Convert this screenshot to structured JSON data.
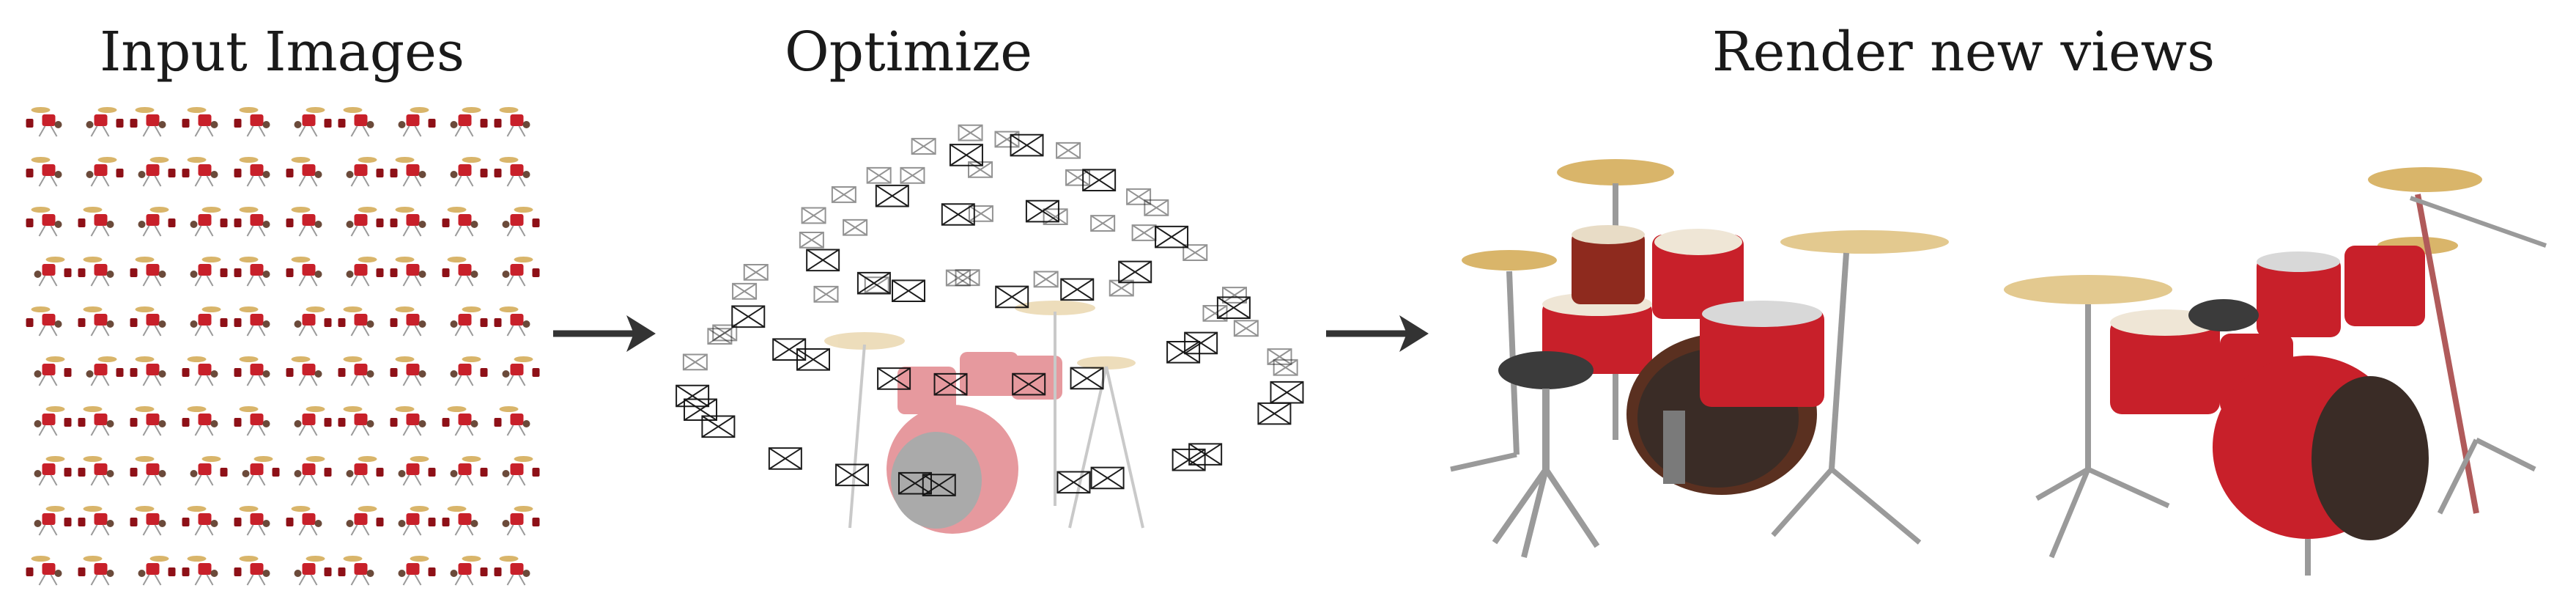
{
  "titles": {
    "input": "Input Images",
    "optimize": "Optimize",
    "render": "Render new views"
  },
  "colors": {
    "drum_red": "#c8202a",
    "drum_dark_red": "#8e1017",
    "cymbal_gold": "#d9b56a",
    "chrome": "#9a9a9a",
    "arrow": "#333333",
    "camera_stroke": "#111111"
  },
  "icons": {
    "arrow_1": "right-arrow-icon",
    "arrow_2": "right-arrow-icon",
    "camera": "camera-frustum-icon",
    "drum_kit": "drum-kit-icon"
  },
  "grid": {
    "rows": 10,
    "cols": 10
  }
}
